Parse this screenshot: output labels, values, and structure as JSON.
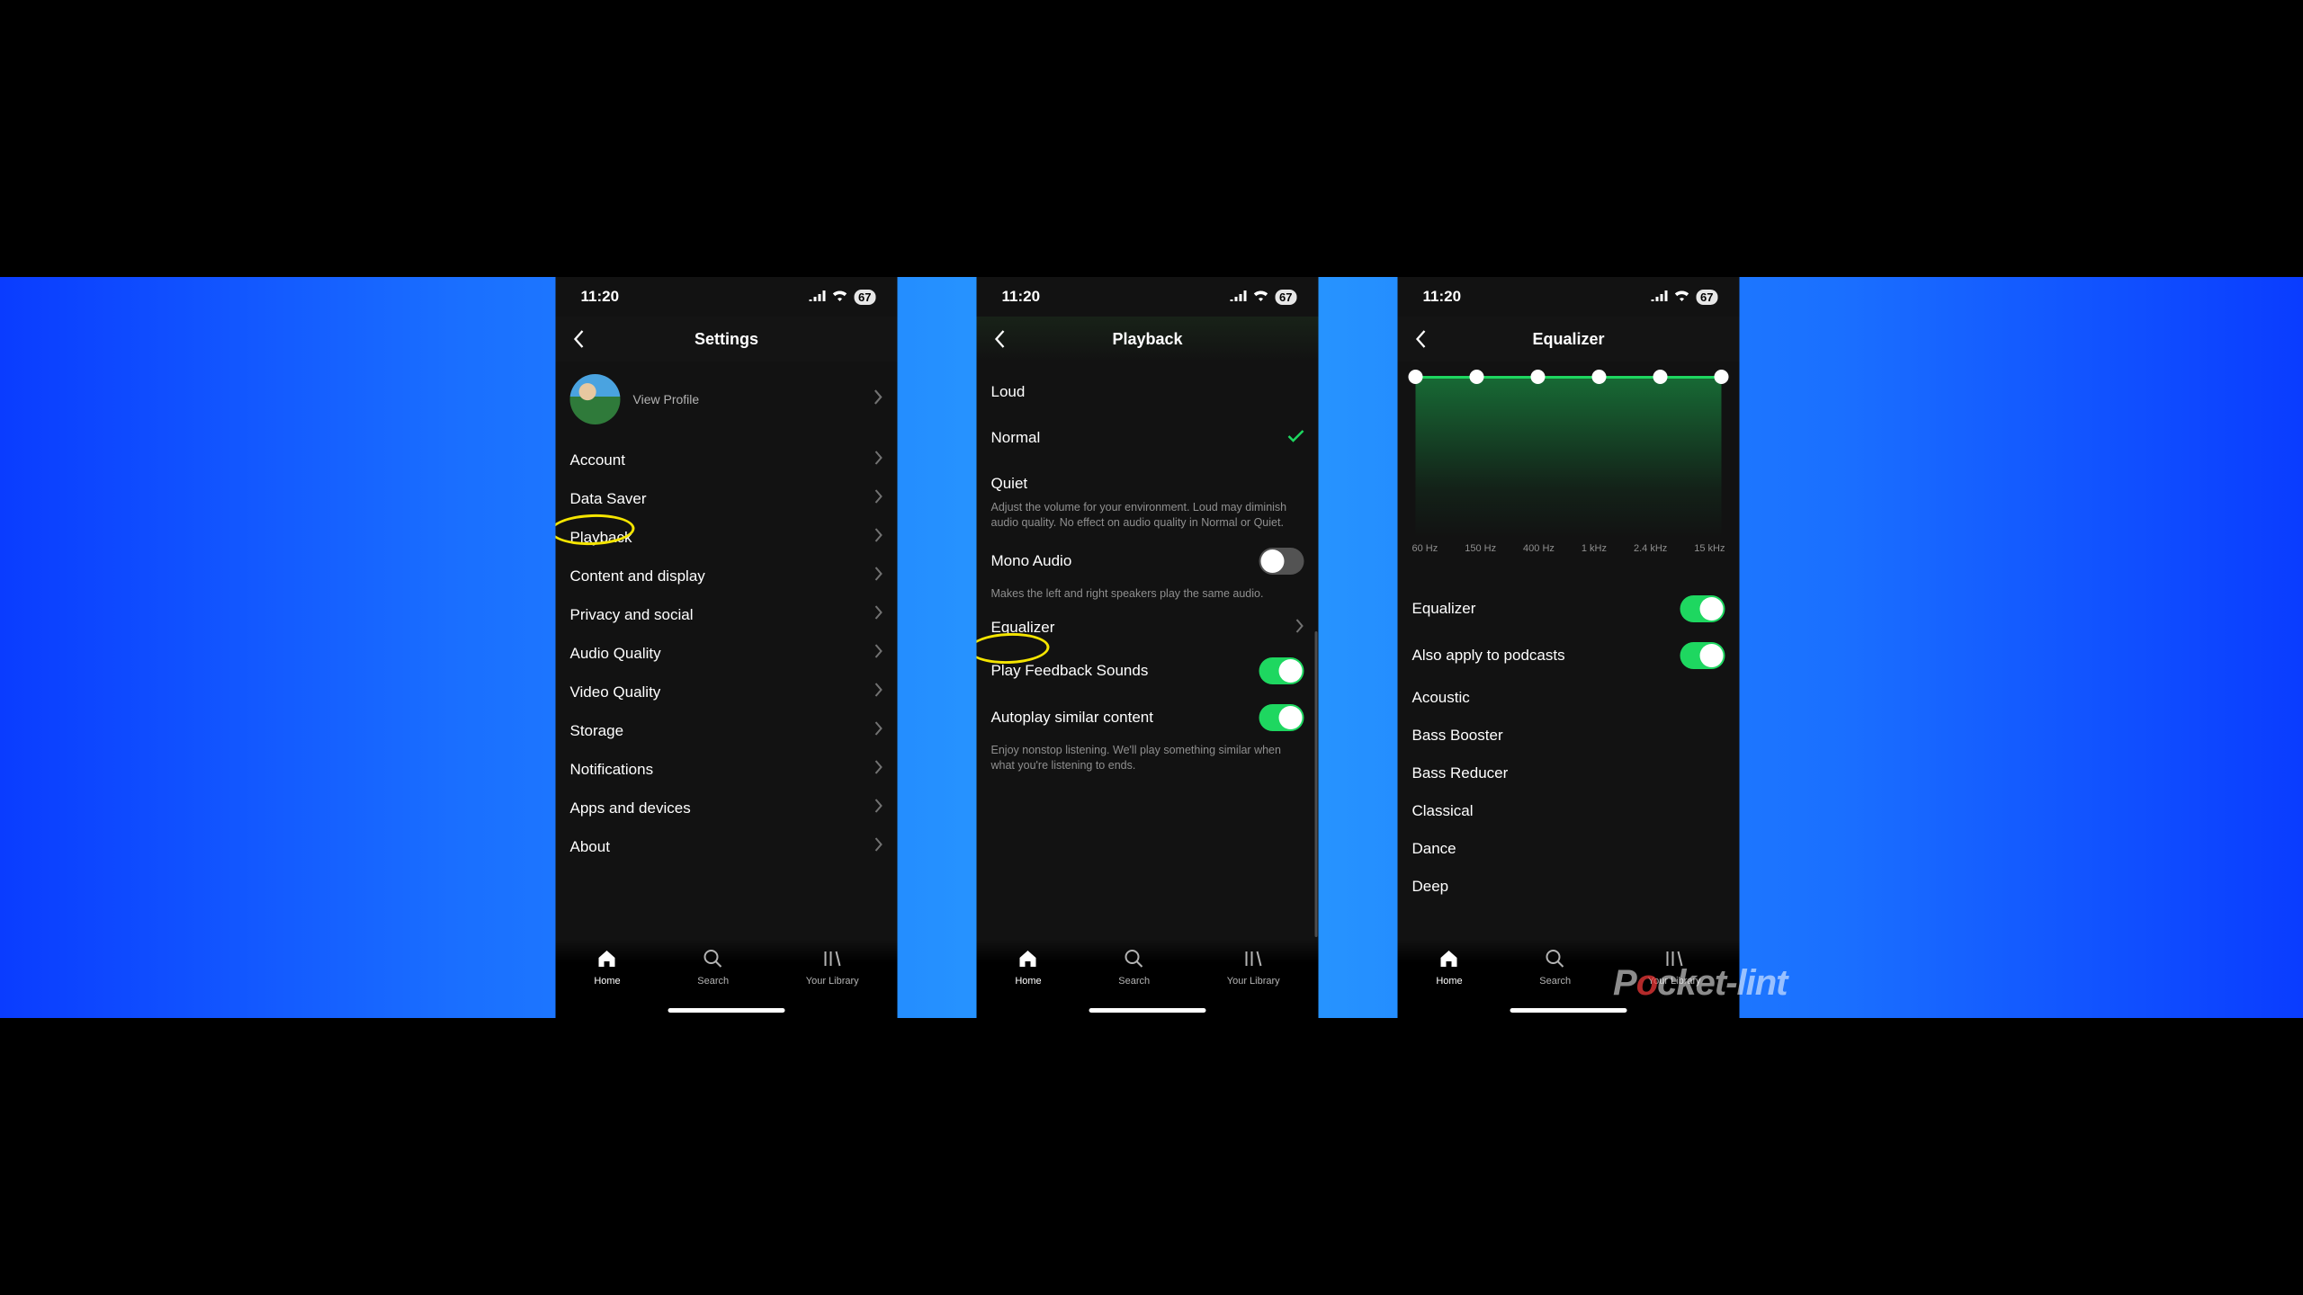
{
  "status": {
    "time": "11:20",
    "battery": "67"
  },
  "tabs": {
    "home": "Home",
    "search": "Search",
    "library": "Your Library"
  },
  "settings": {
    "title": "Settings",
    "profile_label": "View Profile",
    "items": [
      "Account",
      "Data Saver",
      "Playback",
      "Content and display",
      "Privacy and social",
      "Audio Quality",
      "Video Quality",
      "Storage",
      "Notifications",
      "Apps and devices",
      "About"
    ]
  },
  "playback": {
    "title": "Playback",
    "levels": [
      "Loud",
      "Normal",
      "Quiet"
    ],
    "selected": 1,
    "volume_desc": "Adjust the volume for your environment. Loud may diminish audio quality. No effect on audio quality in Normal or Quiet.",
    "mono_label": "Mono Audio",
    "mono_desc": "Makes the left and right speakers play the same audio.",
    "equalizer_label": "Equalizer",
    "feedback_label": "Play Feedback Sounds",
    "autoplay_label": "Autoplay similar content",
    "autoplay_desc": "Enjoy nonstop listening. We'll play something similar when what you're listening to ends."
  },
  "equalizer": {
    "title": "Equalizer",
    "bands": [
      "60 Hz",
      "150 Hz",
      "400 Hz",
      "1 kHz",
      "2.4 kHz",
      "15 kHz"
    ],
    "switch_label": "Equalizer",
    "podcast_label": "Also apply to podcasts",
    "presets": [
      "Acoustic",
      "Bass Booster",
      "Bass Reducer",
      "Classical",
      "Dance",
      "Deep"
    ]
  },
  "watermark_a": "P",
  "watermark_b": "cket-lint",
  "colors": {
    "accent": "#1ed760",
    "annotation": "#f5e500"
  }
}
